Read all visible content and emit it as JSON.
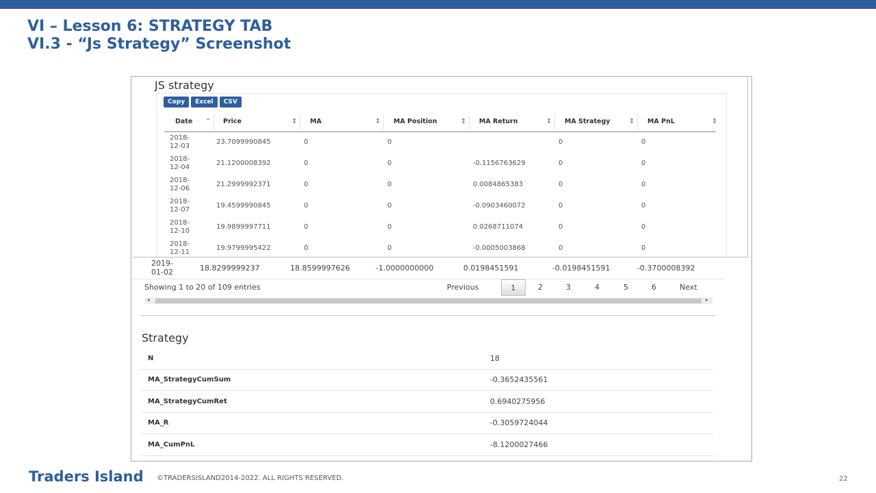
{
  "slide": {
    "title_line1": "VI – Lesson 6: STRATEGY TAB",
    "title_line2": "VI.3 - “Js Strategy” Screenshot",
    "footer_brand": "Traders Island",
    "footer_copy": "©TRADERSISLAND2014-2022. ALL RIGHTS RESERVED.",
    "page_number": "22",
    "accent_color": "#2e5f9e"
  },
  "js_strategy": {
    "title": "JS strategy",
    "buttons": [
      "Copy",
      "Excel",
      "CSV"
    ],
    "columns": [
      "Date",
      "Price",
      "MA",
      "MA Position",
      "MA Return",
      "MA Strategy",
      "MA PnL"
    ],
    "sort_icons": [
      "sort-asc-icon",
      "sort-both-icon"
    ],
    "rows": [
      {
        "date": "2018-12-03",
        "price": "23.7099990845",
        "ma": "0",
        "position": "0",
        "ret": "",
        "strategy": "0",
        "pnl": "0"
      },
      {
        "date": "2018-12-04",
        "price": "21.1200008392",
        "ma": "0",
        "position": "0",
        "ret": "-0.1156763629",
        "strategy": "0",
        "pnl": "0"
      },
      {
        "date": "2018-12-06",
        "price": "21.2999992371",
        "ma": "0",
        "position": "0",
        "ret": "0.0084865383",
        "strategy": "0",
        "pnl": "0"
      },
      {
        "date": "2018-12-07",
        "price": "19.4599990845",
        "ma": "0",
        "position": "0",
        "ret": "-0.0903460072",
        "strategy": "0",
        "pnl": "0"
      },
      {
        "date": "2018-12-10",
        "price": "19.9899997711",
        "ma": "0",
        "position": "0",
        "ret": "0.0268711074",
        "strategy": "0",
        "pnl": "0"
      },
      {
        "date": "2018-12-11",
        "price": "19.9799995422",
        "ma": "0",
        "position": "0",
        "ret": "-0.0005003868",
        "strategy": "0",
        "pnl": "0"
      }
    ],
    "last_row": {
      "date": "2019-01-02",
      "price": "18.8299999237",
      "ma": "18.8599997626",
      "position": "-1.0000000000",
      "ret": "0.0198451591",
      "strategy": "-0.0198451591",
      "pnl": "-0.3700008392"
    },
    "info": "Showing 1 to 20 of 109 entries",
    "pagination": {
      "previous": "Previous",
      "pages": [
        "1",
        "2",
        "3",
        "4",
        "5",
        "6"
      ],
      "next": "Next",
      "current": "1"
    },
    "scroll_left": "◂",
    "scroll_right": "▸"
  },
  "strategy": {
    "title": "Strategy",
    "rows": [
      {
        "label": "N",
        "value": "18"
      },
      {
        "label": "MA_StrategyCumSum",
        "value": "-0.3652435561"
      },
      {
        "label": "MA_StrategyCumRet",
        "value": "0.6940275956"
      },
      {
        "label": "MA_R",
        "value": "-0.3059724044"
      },
      {
        "label": "MA_CumPnL",
        "value": "-8.1200027466"
      }
    ]
  }
}
